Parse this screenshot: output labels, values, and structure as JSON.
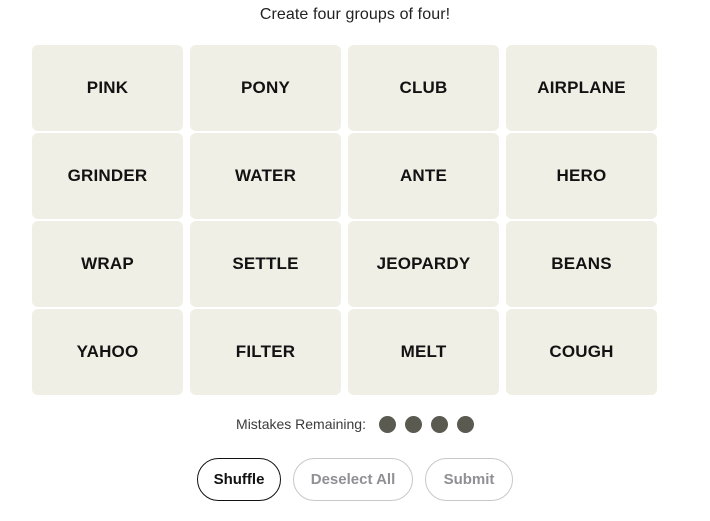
{
  "header": {
    "instruction": "Create four groups of four!"
  },
  "board": {
    "rows": [
      [
        "PINK",
        "PONY",
        "CLUB",
        "AIRPLANE"
      ],
      [
        "GRINDER",
        "WATER",
        "ANTE",
        "HERO"
      ],
      [
        "WRAP",
        "SETTLE",
        "JEOPARDY",
        "BEANS"
      ],
      [
        "YAHOO",
        "FILTER",
        "MELT",
        "COUGH"
      ]
    ],
    "tile_color": "#EFEFE6",
    "tile_text_color": "#121212"
  },
  "mistakes": {
    "label": "Mistakes Remaining:",
    "remaining": 4,
    "dot_color": "#5A5A50"
  },
  "controls": {
    "shuffle": {
      "label": "Shuffle",
      "state": "enabled",
      "border_color": "#121212",
      "text_color": "#121212"
    },
    "deselect_all": {
      "label": "Deselect All",
      "state": "disabled",
      "border_color": "#C8C8C8",
      "text_color": "#8F8F94"
    },
    "submit": {
      "label": "Submit",
      "state": "disabled",
      "border_color": "#C8C8C8",
      "text_color": "#8F8F94"
    }
  },
  "page": {
    "background": "#FFFFFF"
  }
}
